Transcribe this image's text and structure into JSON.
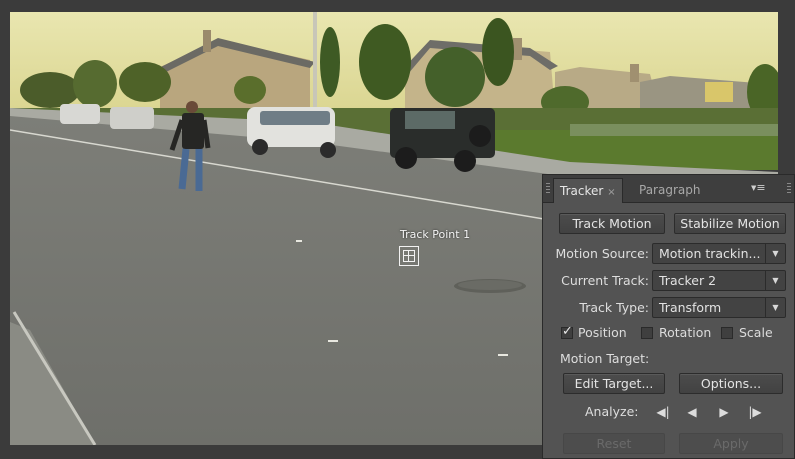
{
  "viewer": {
    "track_point_label": "Track Point 1"
  },
  "panel": {
    "tabs": [
      {
        "label": "Tracker",
        "close": "×",
        "active": true
      },
      {
        "label": "Paragraph",
        "active": false
      }
    ],
    "menu_icon": "panel-menu-icon",
    "track_motion_button": "Track Motion",
    "stabilize_motion_button": "Stabilize Motion",
    "motion_source": {
      "label": "Motion Source:",
      "value": "Motion trackin..."
    },
    "current_track": {
      "label": "Current Track:",
      "value": "Tracker 2"
    },
    "track_type": {
      "label": "Track Type:",
      "value": "Transform"
    },
    "position": {
      "label": "Position",
      "checked": true
    },
    "rotation": {
      "label": "Rotation",
      "checked": false
    },
    "scale": {
      "label": "Scale",
      "checked": false
    },
    "motion_target_label": "Motion Target:",
    "edit_target_button": "Edit Target...",
    "options_button": "Options...",
    "analyze_label": "Analyze:",
    "analyze_buttons": [
      "analyze-backward-one-frame",
      "analyze-backward",
      "analyze-forward",
      "analyze-forward-one-frame"
    ],
    "reset_button": "Reset",
    "apply_button": "Apply"
  },
  "colors": {
    "panel_bg": "#535353",
    "tab_bar_bg": "#3e3e3e",
    "viewer_bg": "#3b3b3b"
  }
}
